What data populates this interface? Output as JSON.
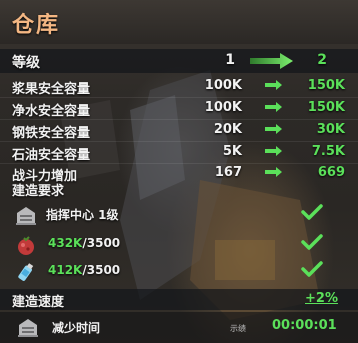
{
  "window": {
    "title": "仓库"
  },
  "levels": {
    "label": "等级",
    "current": "1",
    "next": "2"
  },
  "stats": [
    {
      "label": "浆果安全容量",
      "current": "100K",
      "next": "150K"
    },
    {
      "label": "净水安全容量",
      "current": "100K",
      "next": "150K"
    },
    {
      "label": "钢铁安全容量",
      "current": "20K",
      "next": "30K"
    },
    {
      "label": "石油安全容量",
      "current": "5K",
      "next": "7.5K"
    },
    {
      "label": "战斗力增加",
      "current": "167",
      "next": "669"
    }
  ],
  "requirements": {
    "title": "建造要求",
    "building": {
      "label": "指挥中心 1级"
    },
    "berries": {
      "have": "432K",
      "need": "/3500"
    },
    "water": {
      "have": "412K",
      "need": "/3500"
    }
  },
  "speed": {
    "label": "建造速度",
    "value": "+2%"
  },
  "time": {
    "label": "减少时间",
    "value": "00:00:01",
    "tag": "示绩"
  },
  "colors": {
    "accent": "#5be05a",
    "title": "#f4b783"
  }
}
